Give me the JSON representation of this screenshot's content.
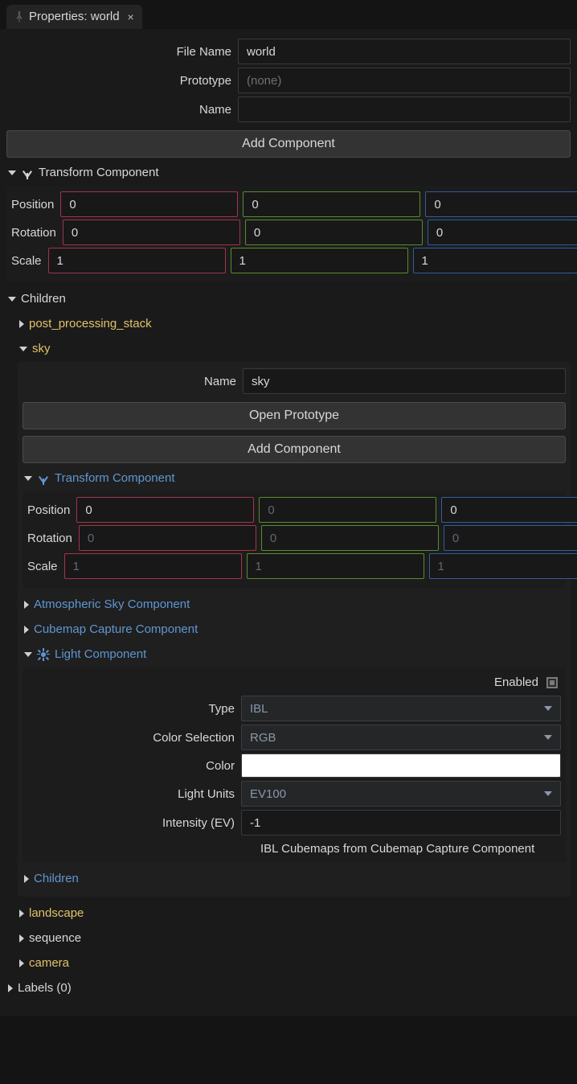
{
  "tab": {
    "title": "Properties: world"
  },
  "top": {
    "file_name_label": "File Name",
    "file_name_value": "world",
    "prototype_label": "Prototype",
    "prototype_placeholder": "(none)",
    "name_label": "Name",
    "name_value": "",
    "add_component": "Add Component"
  },
  "transform": {
    "header": "Transform Component",
    "position_label": "Position",
    "rotation_label": "Rotation",
    "scale_label": "Scale",
    "position": {
      "x": "0",
      "y": "0",
      "z": "0"
    },
    "rotation": {
      "x": "0",
      "y": "0",
      "z": "0"
    },
    "scale": {
      "x": "1",
      "y": "1",
      "z": "1"
    }
  },
  "children_header": "Children",
  "children": {
    "post_processing_stack": "post_processing_stack",
    "sky": "sky",
    "landscape": "landscape",
    "sequence": "sequence",
    "camera": "camera"
  },
  "sky": {
    "name_label": "Name",
    "name_value": "sky",
    "open_prototype": "Open Prototype",
    "add_component": "Add Component",
    "transform_header": "Transform Component",
    "transform": {
      "position_label": "Position",
      "rotation_label": "Rotation",
      "scale_label": "Scale",
      "position": {
        "x": "0",
        "y": "0",
        "z": "0"
      },
      "rotation": {
        "x": "0",
        "y": "0",
        "z": "0"
      },
      "scale": {
        "x": "1",
        "y": "1",
        "z": "1"
      }
    },
    "atmos_header": "Atmospheric Sky Component",
    "cubemap_header": "Cubemap Capture Component",
    "light_header": "Light Component",
    "light": {
      "enabled_label": "Enabled",
      "type_label": "Type",
      "type_value": "IBL",
      "colorsel_label": "Color Selection",
      "colorsel_value": "RGB",
      "color_label": "Color",
      "color_value": "#ffffff",
      "units_label": "Light Units",
      "units_value": "EV100",
      "intensity_label": "Intensity (EV)",
      "intensity_value": "-1",
      "note": "IBL Cubemaps from Cubemap Capture Component"
    },
    "children_header": "Children"
  },
  "labels_header": "Labels (0)"
}
